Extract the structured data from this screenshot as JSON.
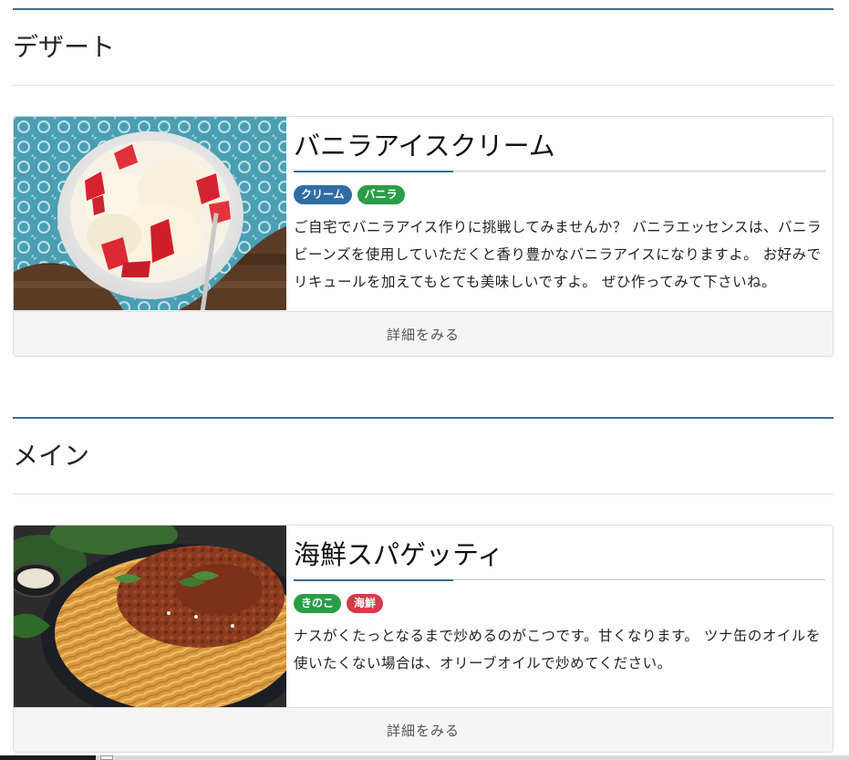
{
  "sections": [
    {
      "title": "デザート",
      "card": {
        "image_label": "vanilla-ice-cream-photo",
        "title": "バニラアイスクリーム",
        "tags": [
          {
            "label": "クリーム",
            "color": "#2e6da4"
          },
          {
            "label": "バニラ",
            "color": "#2a9d47"
          }
        ],
        "description": "ご自宅でバニラアイス作りに挑戦してみませんか？ バニラエッセンスは、バニラビーンズを使用していただくと香り豊かなバニラアイスになりますよ。 お好みでリキュールを加えてもとても美味しいですよ。 ぜひ作ってみて下さいね。",
        "detail_label": "詳細をみる"
      }
    },
    {
      "title": "メイン",
      "card": {
        "image_label": "seafood-spaghetti-photo",
        "title": "海鮮スパゲッティ",
        "tags": [
          {
            "label": "きのこ",
            "color": "#2a9d47"
          },
          {
            "label": "海鮮",
            "color": "#d63a49"
          }
        ],
        "description": "ナスがくたっとなるまで炒めるのがこつです。甘くなります。 ツナ缶のオイルを使いたくない場合は、オリーブオイルで炒めてください。",
        "detail_label": "詳細をみる"
      }
    }
  ],
  "colors": {
    "accent": "#3a6a93",
    "footer_bg": "#f5f5f5",
    "border": "#dcdcdc"
  }
}
